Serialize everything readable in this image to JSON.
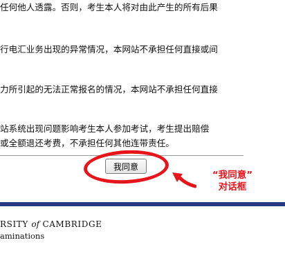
{
  "terms": {
    "line1": "任何他人透露。否则，考生本人将对由此产生的所有后果",
    "line2": "行电汇业务出现的异常情况，本网站不承担任何直接或间",
    "line3": "力所引起的无法正常报名的情况，本网站不承担任何直接",
    "line4": "站系统出现问题影响考生本人参加考试，考生提出赔偿",
    "line5": "或全额退还考费，不承担任何其他连带责任。"
  },
  "agree_button": {
    "label": "我同意"
  },
  "annotation": {
    "line1": "“我同意”",
    "line2": "对话框",
    "color": "#e8141c"
  },
  "footer": {
    "brand_prefix": "RSITY",
    "brand_of": "of",
    "brand_suffix": "CAMBRIDGE",
    "brand_sub": "aminations",
    "bar_color": "#263c7f"
  }
}
